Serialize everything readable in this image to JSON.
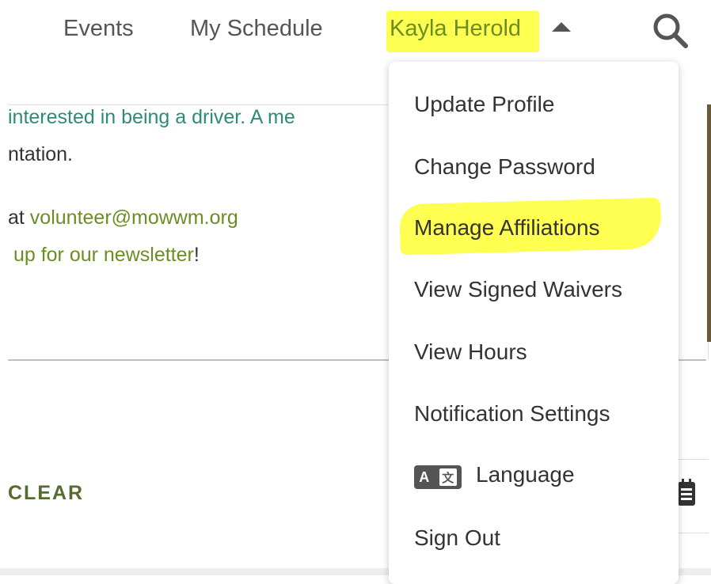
{
  "nav": {
    "events_label": "Events",
    "schedule_label": "My Schedule",
    "user_name": "Kayla Herold",
    "caret_icon": "caret-up-icon",
    "search_icon": "search-icon"
  },
  "content": {
    "line1": "interested in being a driver. A me",
    "line2": "ntation.",
    "line3_prefix": "at ",
    "email": "volunteer@mowwm.org",
    "line4_link": "up for our newsletter",
    "line4_suffix": "!",
    "clear_label": "CLEAR"
  },
  "menu": {
    "items": [
      {
        "label": "Update Profile"
      },
      {
        "label": "Change Password"
      },
      {
        "label": "Manage Affiliations"
      },
      {
        "label": "View Signed Waivers"
      },
      {
        "label": "View Hours"
      },
      {
        "label": "Notification Settings"
      },
      {
        "label": "Language",
        "icon": "translate-icon"
      },
      {
        "label": "Sign Out"
      }
    ],
    "lang_icon_a": "A",
    "lang_icon_b": "文"
  },
  "colors": {
    "accent": "#6b8e23",
    "teal_link": "#2e8b7a",
    "highlight": "#ffff33"
  }
}
